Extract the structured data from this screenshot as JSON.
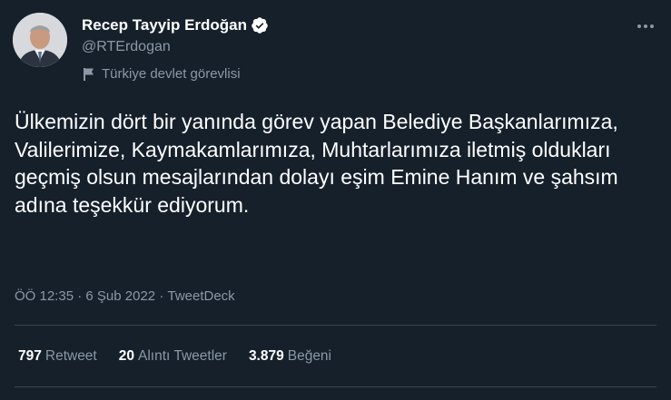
{
  "author": {
    "display_name": "Recep Tayyip Erdoğan",
    "handle": "@RTErdogan",
    "label": "Türkiye devlet görevlisi"
  },
  "tweet": {
    "text": "Ülkemizin dört bir yanında görev yapan Belediye Başkanlarımıza, Valilerimize, Kaymakamlarımıza, Muhtarlarımıza iletmiş oldukları geçmiş olsun mesajlarından dolayı eşim Emine Hanım ve şahsım adına teşekkür ediyorum.",
    "time": "ÖÖ 12:35",
    "date": "6 Şub 2022",
    "source": "TweetDeck",
    "separator": "·"
  },
  "stats": {
    "retweets": {
      "count": "797",
      "label": "Retweet"
    },
    "quotes": {
      "count": "20",
      "label": "Alıntı Tweetler"
    },
    "likes": {
      "count": "3.879",
      "label": "Beğeni"
    }
  },
  "icons": {
    "verified": "verified-badge-icon",
    "flag": "flag-icon",
    "more": "more-icon"
  },
  "colors": {
    "background": "#15202b",
    "text": "#ffffff",
    "muted": "#8b98a5",
    "divider": "#38444d"
  }
}
